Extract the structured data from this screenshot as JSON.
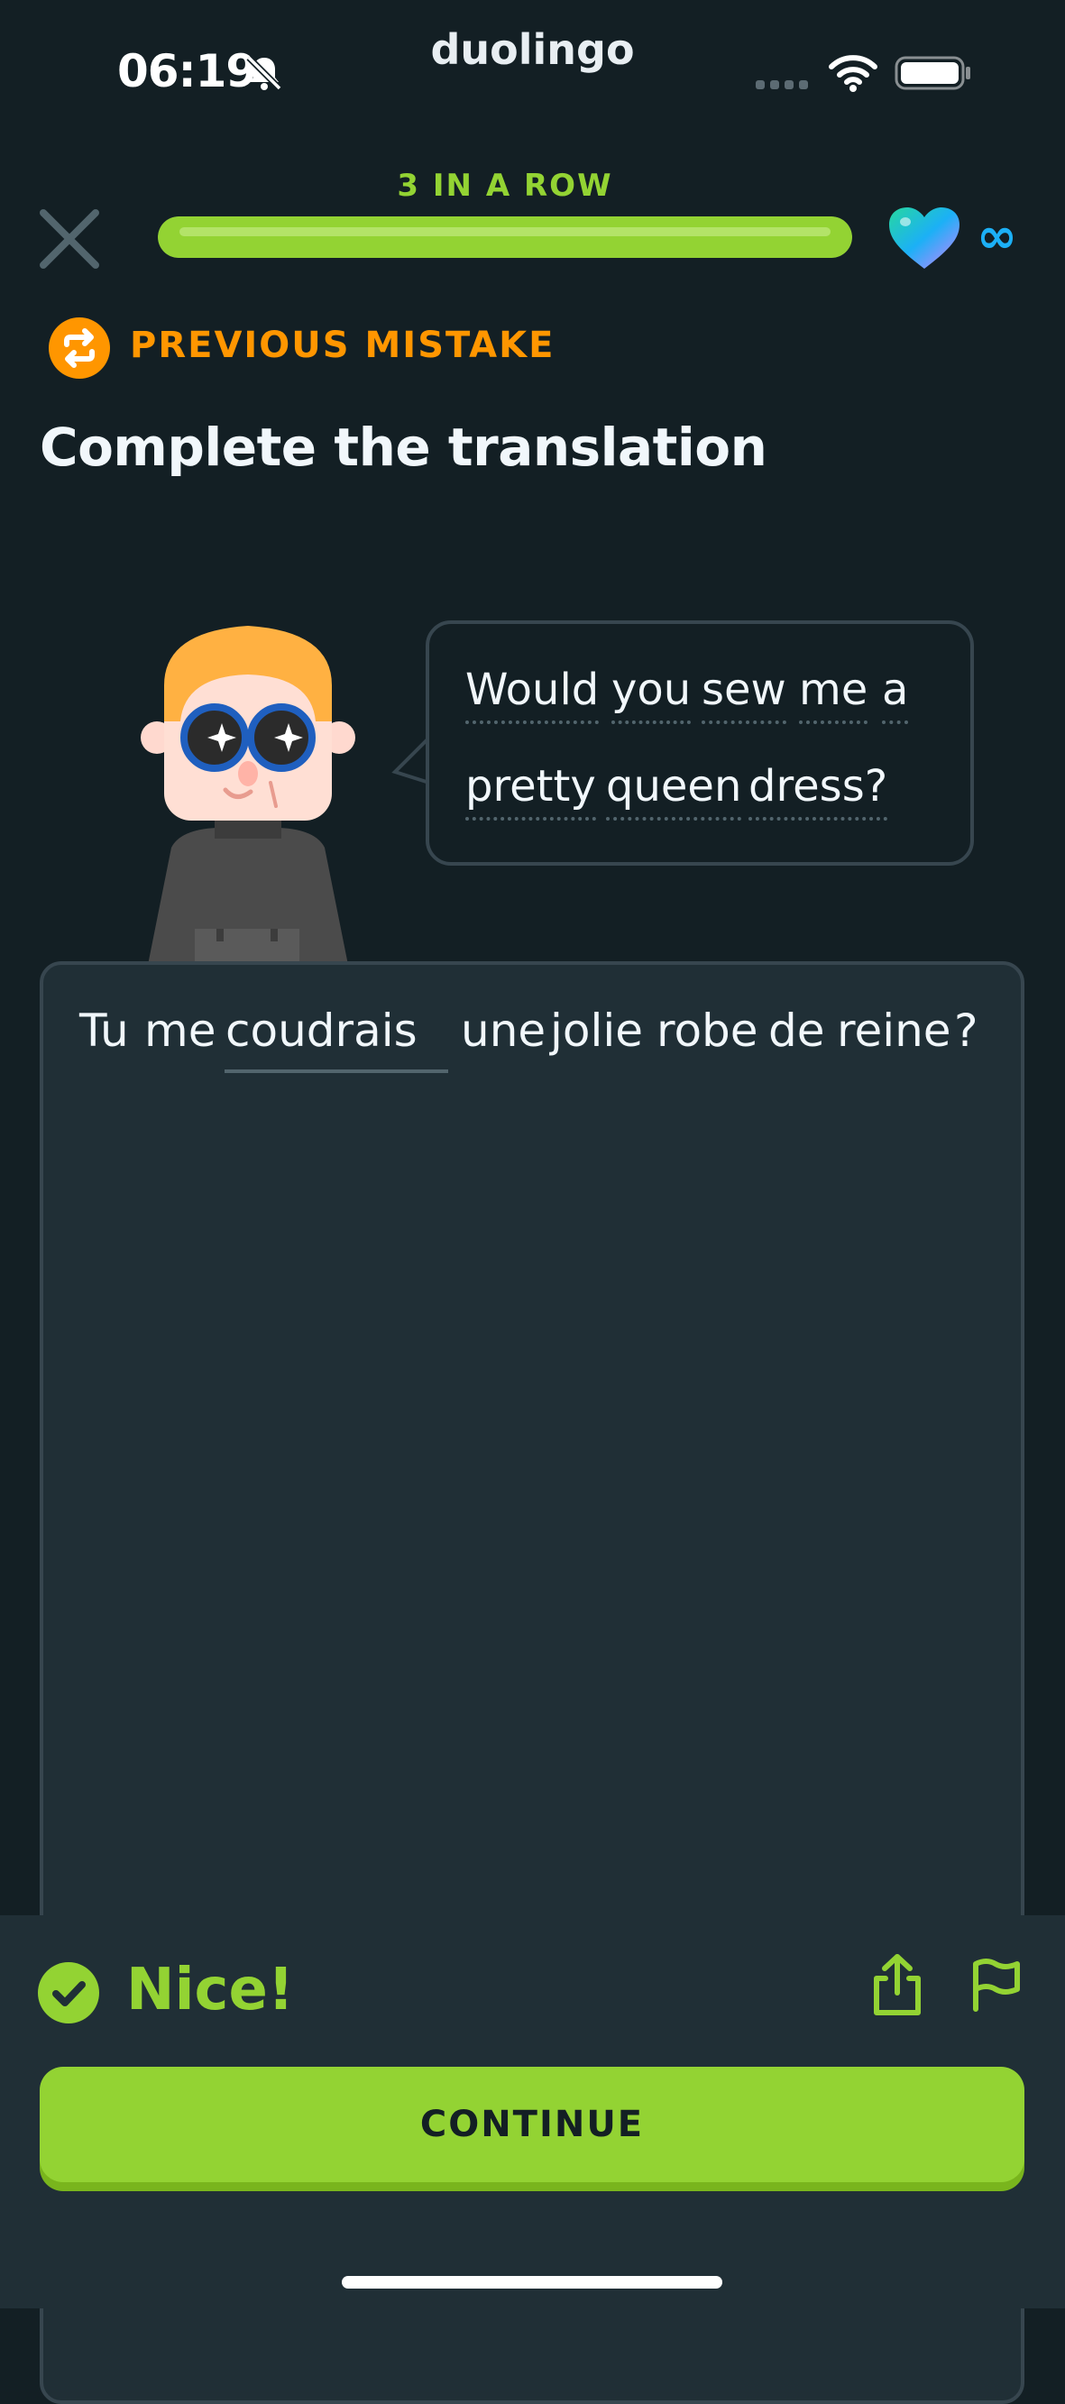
{
  "status_bar": {
    "time": "06:19",
    "app_title": "duolingo",
    "icons": [
      "bell-muted-icon",
      "signal-icon",
      "wifi-icon",
      "battery-icon"
    ]
  },
  "lesson_header": {
    "streak_label": "3 IN A ROW",
    "progress": 1.0,
    "hearts": "∞",
    "close_icon": "close-icon",
    "heart_icon": "heart-icon"
  },
  "mistake_banner": {
    "label": "PREVIOUS MISTAKE",
    "icon": "repeat-icon"
  },
  "exercise": {
    "title": "Complete the translation",
    "prompt_words": [
      "Would",
      "you",
      "sew",
      "me",
      "a",
      "pretty",
      "queen",
      "dress?"
    ],
    "answer": {
      "before_blank": [
        "Tu",
        "me"
      ],
      "filled_word": "coudrais",
      "after_blank": [
        "une",
        "jolie",
        "robe",
        "de",
        "reine",
        "?"
      ]
    }
  },
  "feedback": {
    "message": "Nice!",
    "continue_label": "CONTINUE",
    "icons": [
      "check-circle-icon",
      "share-icon",
      "flag-icon"
    ]
  },
  "colors": {
    "background": "#131f24",
    "panel": "#202f36",
    "border": "#37464f",
    "green": "#93d333",
    "orange": "#ff9600",
    "text": "#f1f7fb"
  }
}
